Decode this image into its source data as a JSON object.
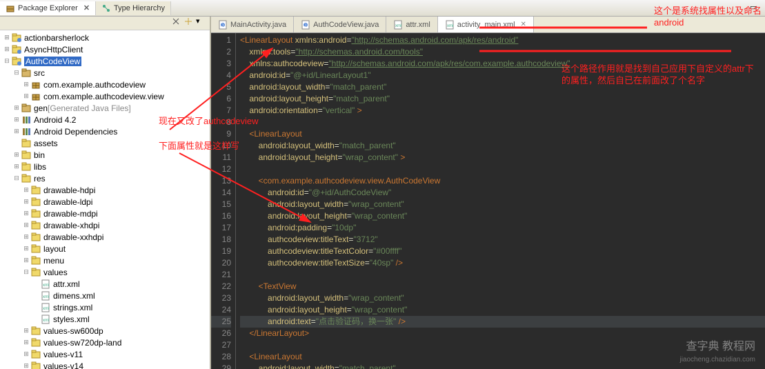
{
  "views": {
    "pkg_explorer": "Package Explorer",
    "type_hier": "Type Hierarchy"
  },
  "editor_tabs": [
    {
      "label": "MainActivity.java",
      "active": false,
      "icon": "java"
    },
    {
      "label": "AuthCodeView.java",
      "active": false,
      "icon": "java"
    },
    {
      "label": "attr.xml",
      "active": false,
      "icon": "xml"
    },
    {
      "label": "activity_main.xml",
      "active": true,
      "icon": "xml"
    }
  ],
  "tree": [
    {
      "d": 0,
      "tw": "+",
      "ic": "proj",
      "t": "actionbarsherlock"
    },
    {
      "d": 0,
      "tw": "+",
      "ic": "proj",
      "t": "AsyncHttpClient"
    },
    {
      "d": 0,
      "tw": "-",
      "ic": "proj",
      "t": "AuthCodeView",
      "sel": true
    },
    {
      "d": 1,
      "tw": "-",
      "ic": "src",
      "t": "src"
    },
    {
      "d": 2,
      "tw": "+",
      "ic": "pkg",
      "t": "com.example.authcodeview"
    },
    {
      "d": 2,
      "tw": "+",
      "ic": "pkg",
      "t": "com.example.authcodeview.view"
    },
    {
      "d": 1,
      "tw": "+",
      "ic": "src",
      "t": "gen",
      "decor": " [Generated Java Files]"
    },
    {
      "d": 1,
      "tw": "+",
      "ic": "lib",
      "t": "Android 4.2"
    },
    {
      "d": 1,
      "tw": "+",
      "ic": "lib",
      "t": "Android Dependencies"
    },
    {
      "d": 1,
      "tw": "",
      "ic": "folder",
      "t": "assets"
    },
    {
      "d": 1,
      "tw": "+",
      "ic": "folder",
      "t": "bin"
    },
    {
      "d": 1,
      "tw": "+",
      "ic": "folder",
      "t": "libs"
    },
    {
      "d": 1,
      "tw": "-",
      "ic": "folder",
      "t": "res"
    },
    {
      "d": 2,
      "tw": "+",
      "ic": "folder",
      "t": "drawable-hdpi"
    },
    {
      "d": 2,
      "tw": "+",
      "ic": "folder",
      "t": "drawable-ldpi"
    },
    {
      "d": 2,
      "tw": "+",
      "ic": "folder",
      "t": "drawable-mdpi"
    },
    {
      "d": 2,
      "tw": "+",
      "ic": "folder",
      "t": "drawable-xhdpi"
    },
    {
      "d": 2,
      "tw": "+",
      "ic": "folder",
      "t": "drawable-xxhdpi"
    },
    {
      "d": 2,
      "tw": "+",
      "ic": "folder",
      "t": "layout"
    },
    {
      "d": 2,
      "tw": "+",
      "ic": "folder",
      "t": "menu"
    },
    {
      "d": 2,
      "tw": "-",
      "ic": "folder",
      "t": "values"
    },
    {
      "d": 3,
      "tw": "",
      "ic": "xml",
      "t": "attr.xml"
    },
    {
      "d": 3,
      "tw": "",
      "ic": "xml",
      "t": "dimens.xml"
    },
    {
      "d": 3,
      "tw": "",
      "ic": "xml",
      "t": "strings.xml"
    },
    {
      "d": 3,
      "tw": "",
      "ic": "xml",
      "t": "styles.xml"
    },
    {
      "d": 2,
      "tw": "+",
      "ic": "folder",
      "t": "values-sw600dp"
    },
    {
      "d": 2,
      "tw": "+",
      "ic": "folder",
      "t": "values-sw720dp-land"
    },
    {
      "d": 2,
      "tw": "+",
      "ic": "folder",
      "t": "values-v11"
    },
    {
      "d": 2,
      "tw": "+",
      "ic": "folder",
      "t": "values-v14"
    }
  ],
  "code": {
    "lines": [
      [
        [
          "tag",
          "<LinearLayout "
        ],
        [
          "attr",
          "xmlns:android"
        ],
        [
          "punc",
          "="
        ],
        [
          "str-und",
          "\"http://schemas.android.com/apk/res/android\""
        ]
      ],
      [
        [
          "punc",
          "    "
        ],
        [
          "attr",
          "xmlns:tools"
        ],
        [
          "punc",
          "="
        ],
        [
          "str-und",
          "\"http://schemas.android.com/tools\""
        ]
      ],
      [
        [
          "punc",
          "    "
        ],
        [
          "attr",
          "xmlns:authcodeview"
        ],
        [
          "punc",
          "="
        ],
        [
          "str-und",
          "\"http://schemas.android.com/apk/res/com.example.authcodeview\""
        ]
      ],
      [
        [
          "punc",
          "    "
        ],
        [
          "attr",
          "android:id"
        ],
        [
          "punc",
          "="
        ],
        [
          "str",
          "\"@+id/LinearLayout1\""
        ]
      ],
      [
        [
          "punc",
          "    "
        ],
        [
          "attr",
          "android:layout_width"
        ],
        [
          "punc",
          "="
        ],
        [
          "str",
          "\"match_parent\""
        ]
      ],
      [
        [
          "punc",
          "    "
        ],
        [
          "attr",
          "android:layout_height"
        ],
        [
          "punc",
          "="
        ],
        [
          "str",
          "\"match_parent\""
        ]
      ],
      [
        [
          "punc",
          "    "
        ],
        [
          "attr",
          "android:orientation"
        ],
        [
          "punc",
          "="
        ],
        [
          "str",
          "\"vertical\""
        ],
        [
          "tag",
          " >"
        ]
      ],
      [
        [
          "punc",
          ""
        ]
      ],
      [
        [
          "punc",
          "    "
        ],
        [
          "tag",
          "<LinearLayout"
        ]
      ],
      [
        [
          "punc",
          "        "
        ],
        [
          "attr",
          "android:layout_width"
        ],
        [
          "punc",
          "="
        ],
        [
          "str",
          "\"match_parent\""
        ]
      ],
      [
        [
          "punc",
          "        "
        ],
        [
          "attr",
          "android:layout_height"
        ],
        [
          "punc",
          "="
        ],
        [
          "str",
          "\"wrap_content\""
        ],
        [
          "tag",
          " >"
        ]
      ],
      [
        [
          "punc",
          ""
        ]
      ],
      [
        [
          "punc",
          "        "
        ],
        [
          "tag",
          "<com.example.authcodeview.view.AuthCodeView"
        ]
      ],
      [
        [
          "punc",
          "            "
        ],
        [
          "attr",
          "android:id"
        ],
        [
          "punc",
          "="
        ],
        [
          "str",
          "\"@+id/AuthCodeView\""
        ]
      ],
      [
        [
          "punc",
          "            "
        ],
        [
          "attr",
          "android:layout_width"
        ],
        [
          "punc",
          "="
        ],
        [
          "str",
          "\"wrap_content\""
        ]
      ],
      [
        [
          "punc",
          "            "
        ],
        [
          "attr",
          "android:layout_height"
        ],
        [
          "punc",
          "="
        ],
        [
          "str",
          "\"wrap_content\""
        ]
      ],
      [
        [
          "punc",
          "            "
        ],
        [
          "attr",
          "android:padding"
        ],
        [
          "punc",
          "="
        ],
        [
          "str",
          "\"10dp\""
        ]
      ],
      [
        [
          "punc",
          "            "
        ],
        [
          "attr",
          "authcodeview:titleText"
        ],
        [
          "punc",
          "="
        ],
        [
          "str",
          "\"3712\""
        ]
      ],
      [
        [
          "punc",
          "            "
        ],
        [
          "attr",
          "authcodeview:titleTextColor"
        ],
        [
          "punc",
          "="
        ],
        [
          "str",
          "\"#00ffff\""
        ]
      ],
      [
        [
          "punc",
          "            "
        ],
        [
          "attr",
          "authcodeview:titleTextSize"
        ],
        [
          "punc",
          "="
        ],
        [
          "str",
          "\"40sp\""
        ],
        [
          "tag",
          " />"
        ]
      ],
      [
        [
          "punc",
          ""
        ]
      ],
      [
        [
          "punc",
          "        "
        ],
        [
          "tag",
          "<TextView"
        ]
      ],
      [
        [
          "punc",
          "            "
        ],
        [
          "attr",
          "android:layout_width"
        ],
        [
          "punc",
          "="
        ],
        [
          "str",
          "\"wrap_content\""
        ]
      ],
      [
        [
          "punc",
          "            "
        ],
        [
          "attr",
          "android:layout_height"
        ],
        [
          "punc",
          "="
        ],
        [
          "str",
          "\"wrap_content\""
        ]
      ],
      [
        [
          "punc",
          "            "
        ],
        [
          "attr",
          "android:text"
        ],
        [
          "punc",
          "="
        ],
        [
          "str",
          "\"点击验证码，换一张\""
        ],
        [
          "tag",
          " />"
        ]
      ],
      [
        [
          "punc",
          "    "
        ],
        [
          "tag",
          "</LinearLayout>"
        ]
      ],
      [
        [
          "punc",
          ""
        ]
      ],
      [
        [
          "punc",
          "    "
        ],
        [
          "tag",
          "<LinearLayout"
        ]
      ],
      [
        [
          "punc",
          "        "
        ],
        [
          "attr",
          "android:layout_width"
        ],
        [
          "punc",
          "="
        ],
        [
          "str",
          "\"match_parent\""
        ]
      ]
    ],
    "current_line": 25
  },
  "annotations": {
    "a1": "这个是系统找属性以及命名android",
    "a2": "这个路径作用就是找到自己应用下自定义的attr下的属性，然后自已在前面改了个名字",
    "a3": "现在又改了authcodeview",
    "a4": "下面属性就是这样写"
  },
  "watermark": {
    "main": "查字典  教程网",
    "sub": "jiaocheng.chazidian.com"
  },
  "chart_data": {
    "type": "table",
    "title": "activity_main.xml source lines",
    "columns": [
      "line",
      "content"
    ],
    "rows": [
      [
        1,
        "<LinearLayout xmlns:android=\"http://schemas.android.com/apk/res/android\""
      ],
      [
        2,
        "    xmlns:tools=\"http://schemas.android.com/tools\""
      ],
      [
        3,
        "    xmlns:authcodeview=\"http://schemas.android.com/apk/res/com.example.authcodeview\""
      ],
      [
        4,
        "    android:id=\"@+id/LinearLayout1\""
      ],
      [
        5,
        "    android:layout_width=\"match_parent\""
      ],
      [
        6,
        "    android:layout_height=\"match_parent\""
      ],
      [
        7,
        "    android:orientation=\"vertical\" >"
      ],
      [
        8,
        ""
      ],
      [
        9,
        "    <LinearLayout"
      ],
      [
        10,
        "        android:layout_width=\"match_parent\""
      ],
      [
        11,
        "        android:layout_height=\"wrap_content\" >"
      ],
      [
        12,
        ""
      ],
      [
        13,
        "        <com.example.authcodeview.view.AuthCodeView"
      ],
      [
        14,
        "            android:id=\"@+id/AuthCodeView\""
      ],
      [
        15,
        "            android:layout_width=\"wrap_content\""
      ],
      [
        16,
        "            android:layout_height=\"wrap_content\""
      ],
      [
        17,
        "            android:padding=\"10dp\""
      ],
      [
        18,
        "            authcodeview:titleText=\"3712\""
      ],
      [
        19,
        "            authcodeview:titleTextColor=\"#00ffff\""
      ],
      [
        20,
        "            authcodeview:titleTextSize=\"40sp\" />"
      ],
      [
        21,
        ""
      ],
      [
        22,
        "        <TextView"
      ],
      [
        23,
        "            android:layout_width=\"wrap_content\""
      ],
      [
        24,
        "            android:layout_height=\"wrap_content\""
      ],
      [
        25,
        "            android:text=\"点击验证码，换一张\" />"
      ],
      [
        26,
        "    </LinearLayout>"
      ],
      [
        27,
        ""
      ],
      [
        28,
        "    <LinearLayout"
      ],
      [
        29,
        "        android:layout_width=\"match_parent\""
      ]
    ]
  }
}
